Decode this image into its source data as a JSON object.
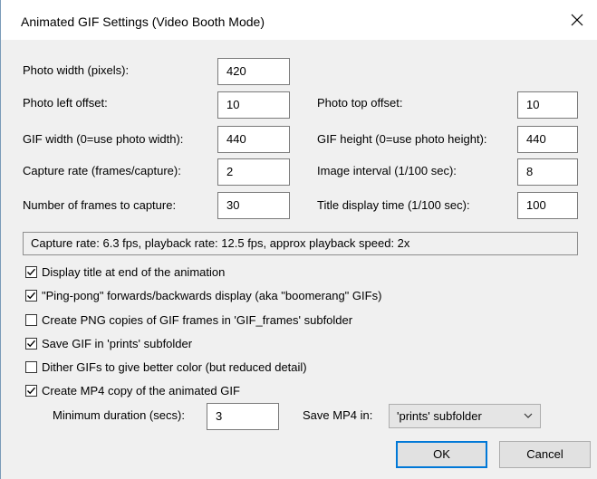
{
  "window": {
    "title": "Animated GIF Settings (Video Booth Mode)"
  },
  "fields": {
    "photo_width": {
      "label": "Photo width (pixels):",
      "value": "420"
    },
    "photo_left_offset": {
      "label": "Photo left offset:",
      "value": "10"
    },
    "photo_top_offset": {
      "label": "Photo top offset:",
      "value": "10"
    },
    "gif_width": {
      "label": "GIF width (0=use photo width):",
      "value": "440"
    },
    "gif_height": {
      "label": "GIF height (0=use photo height):",
      "value": "440"
    },
    "capture_rate": {
      "label": "Capture rate (frames/capture):",
      "value": "2"
    },
    "image_interval": {
      "label": "Image interval (1/100 sec):",
      "value": "8"
    },
    "frames_to_capture": {
      "label": "Number of frames to capture:",
      "value": "30"
    },
    "title_display_time": {
      "label": "Title display time (1/100 sec):",
      "value": "100"
    }
  },
  "summary": "Capture rate: 6.3 fps, playback rate: 12.5 fps, approx playback speed: 2x",
  "checkboxes": [
    {
      "label": "Display title at end of the animation",
      "checked": true
    },
    {
      "label": "\"Ping-pong\" forwards/backwards display (aka \"boomerang\" GIFs)",
      "checked": true
    },
    {
      "label": "Create PNG copies of GIF frames in 'GIF_frames' subfolder",
      "checked": false
    },
    {
      "label": "Save GIF in 'prints' subfolder",
      "checked": true
    },
    {
      "label": "Dither GIFs to give better color (but reduced detail)",
      "checked": false
    },
    {
      "label": "Create MP4 copy of the animated GIF",
      "checked": true
    }
  ],
  "mp4": {
    "min_duration_label": "Minimum duration (secs):",
    "min_duration_value": "3",
    "save_label": "Save MP4 in:",
    "save_value": "'prints' subfolder"
  },
  "buttons": {
    "ok": "OK",
    "cancel": "Cancel"
  },
  "icons": {
    "close": "close-icon",
    "check": "checkmark-icon",
    "dropdown": "chevron-down-icon"
  },
  "colors": {
    "dialog_bg": "#f0f0f0",
    "titlebar_bg": "#ffffff",
    "default_button_border": "#0078d7"
  }
}
